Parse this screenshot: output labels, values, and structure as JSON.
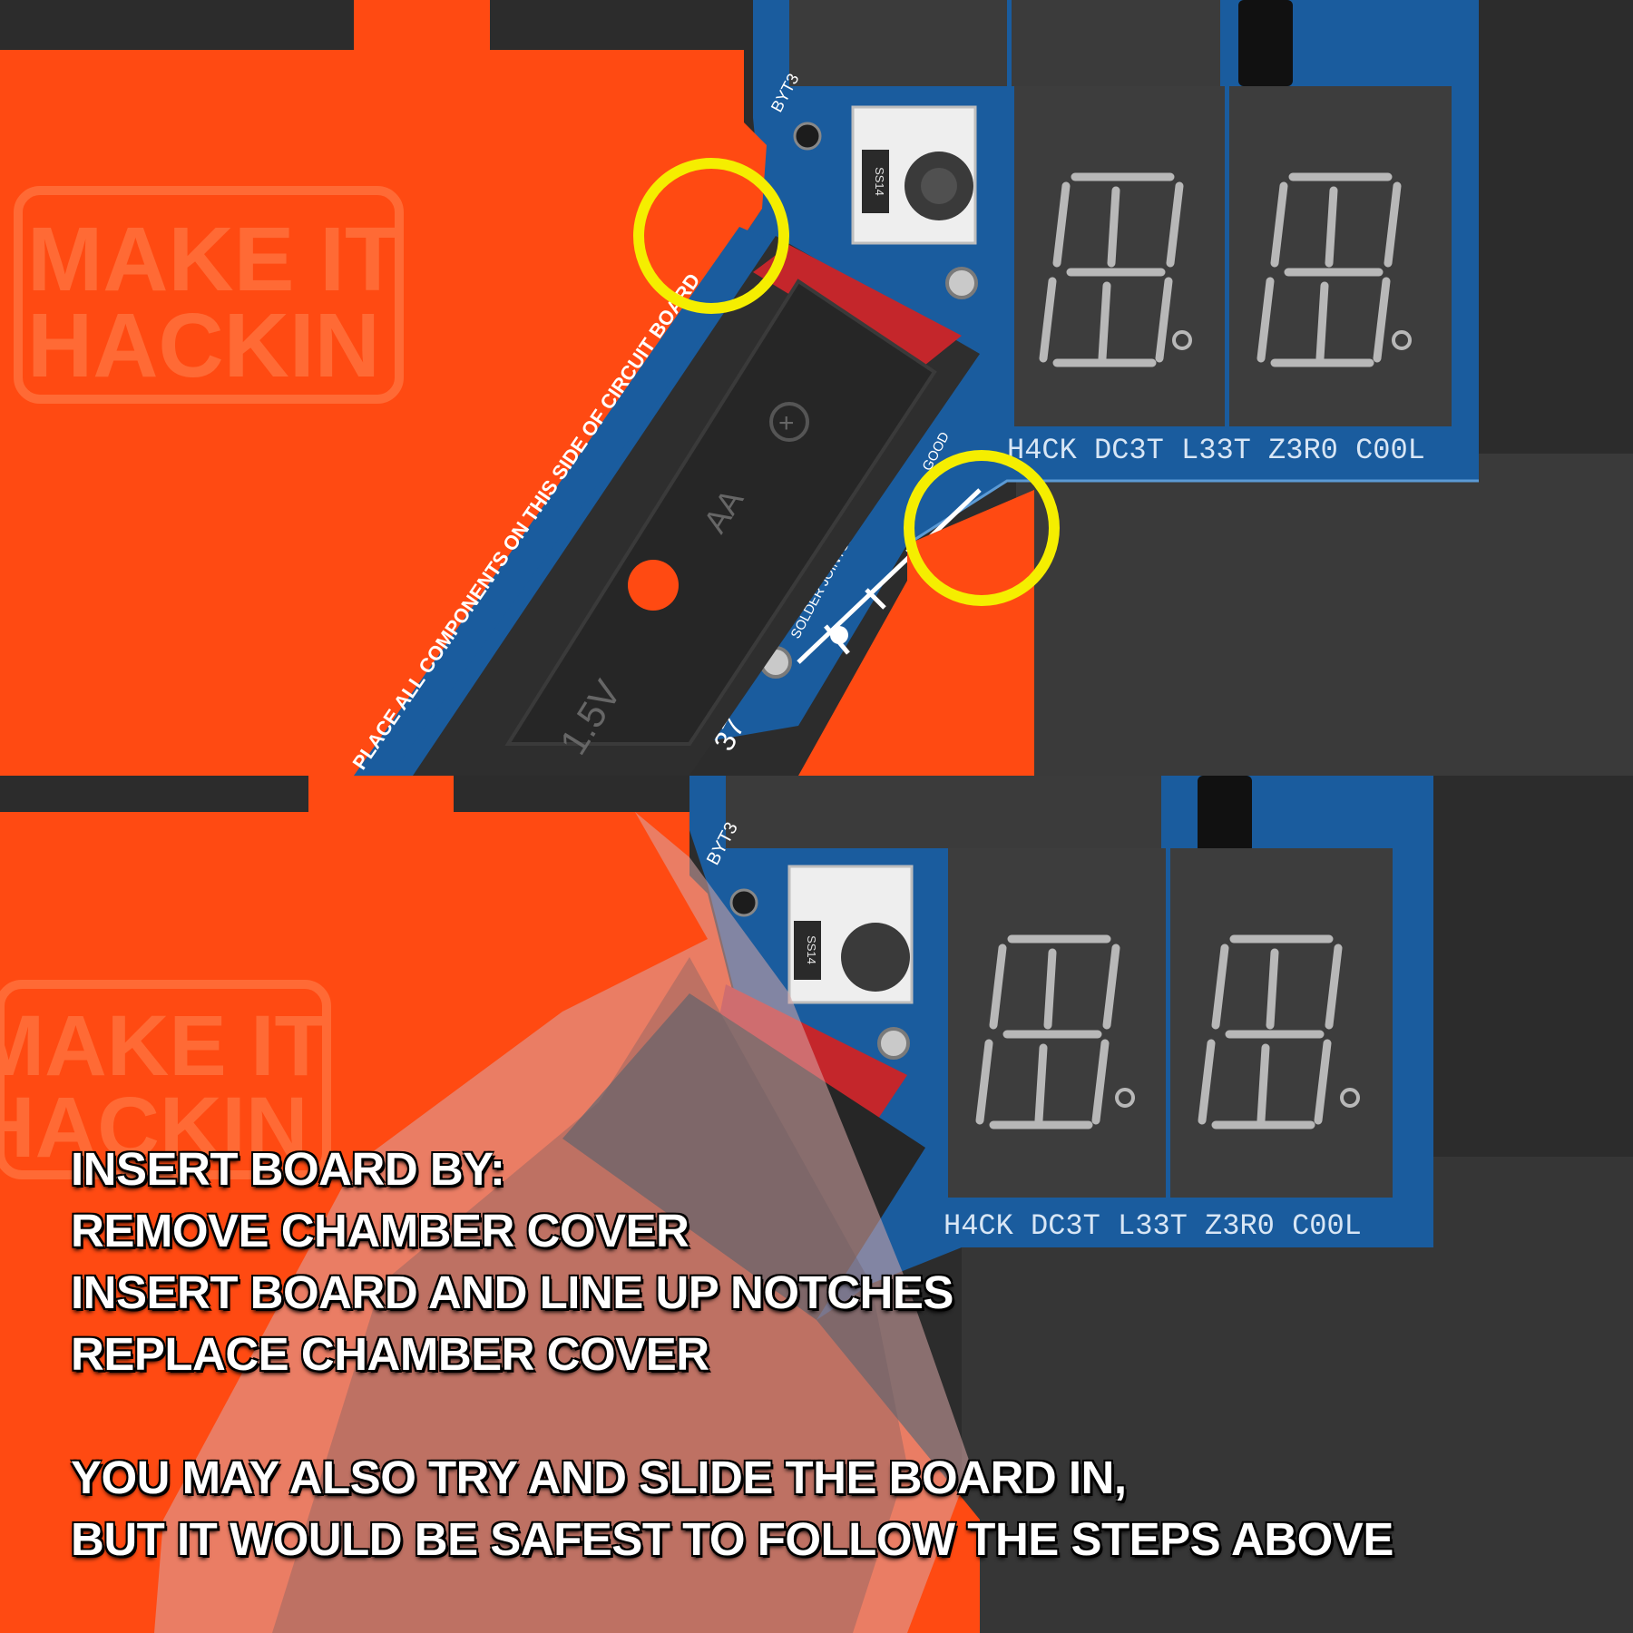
{
  "instructions": {
    "heading": "INSERT BOARD BY:",
    "steps": [
      "REMOVE CHAMBER COVER",
      "INSERT BOARD AND LINE UP NOTCHES",
      "REPLACE CHAMBER COVER"
    ],
    "note_lines": [
      "YOU MAY ALSO TRY AND SLIDE THE BOARD IN,",
      "BUT IT WOULD BE SAFEST TO FOLLOW THE STEPS ABOVE"
    ]
  },
  "photo_text": {
    "case_logo_line1": "MAKE IT",
    "case_logo_line2": "HACKIN",
    "board_silkscreen": "PLACE ALL COMPONENTS ON THIS SIDE OF CIRCUIT BOARD",
    "board_footer": "H4CK DC3T L33T Z3R0 C00L",
    "solder_label_bad": "SOLDER JOINTS: BAD",
    "solder_label_good": "GOOD",
    "battery_label": "1.5V",
    "battery_size": "AA",
    "battery_plus": "+",
    "diode_label": "SS14",
    "side_label": "BYT3",
    "side_label_number": "37"
  },
  "colors": {
    "case_orange": "#ff4a12",
    "pcb_blue": "#1a5c9e",
    "highlight_yellow": "#f5ee00",
    "display_gray": "#3b3b3b",
    "background_dark": "#2c2c2c",
    "text_white": "#ffffff"
  }
}
